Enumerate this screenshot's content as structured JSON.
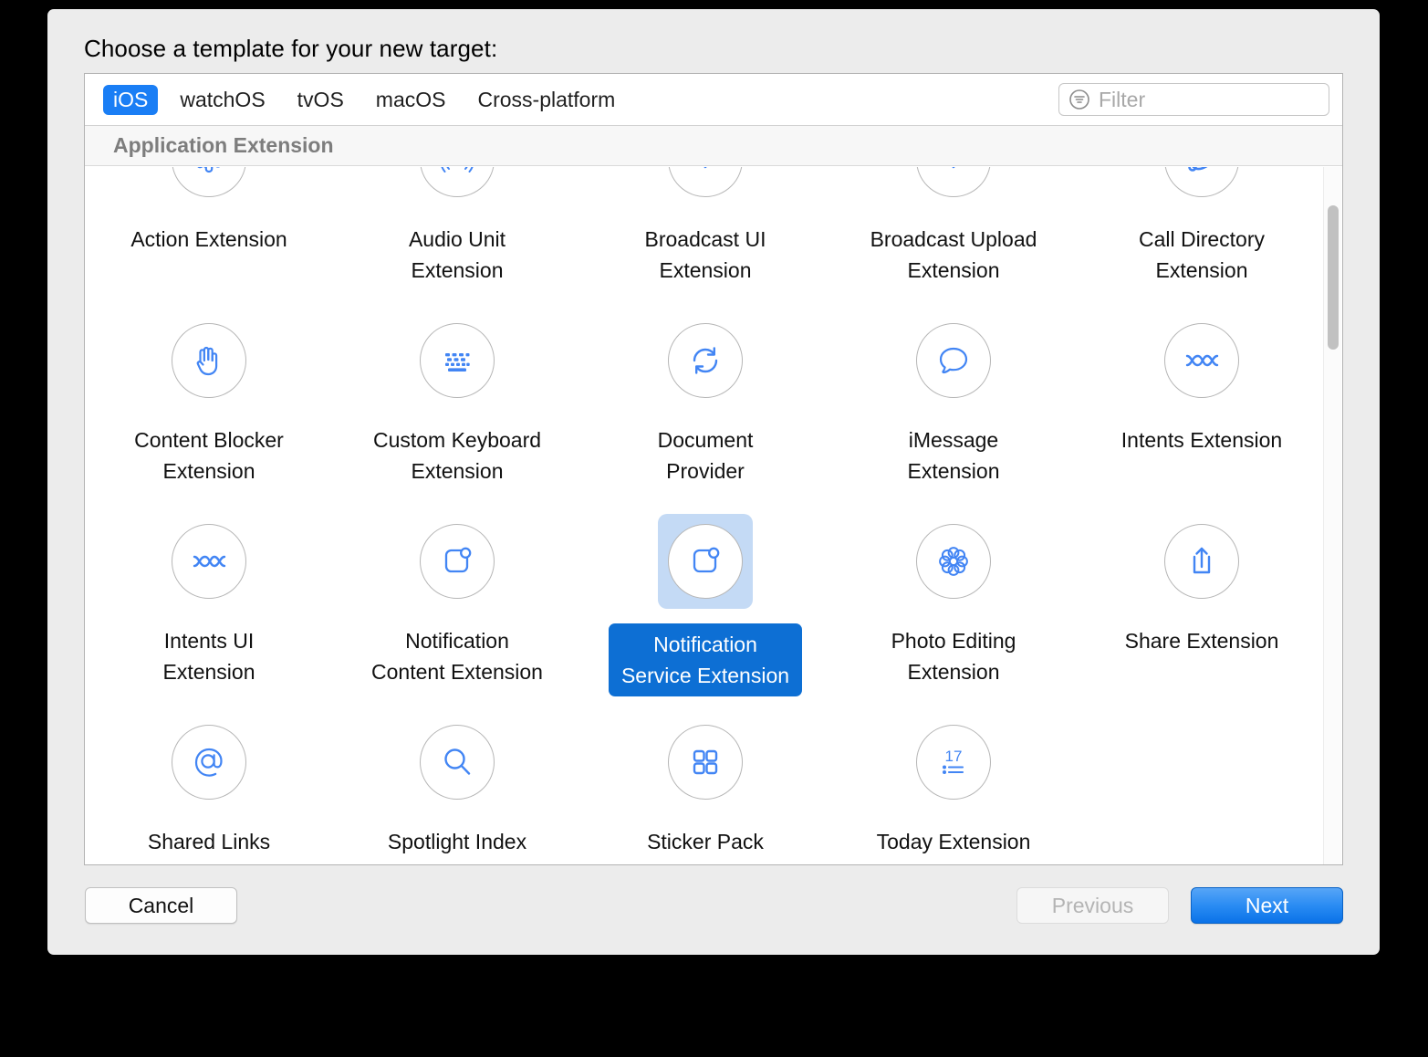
{
  "dialog": {
    "prompt": "Choose a template for your new target:"
  },
  "tabs": [
    {
      "label": "iOS",
      "selected": true
    },
    {
      "label": "watchOS",
      "selected": false
    },
    {
      "label": "tvOS",
      "selected": false
    },
    {
      "label": "macOS",
      "selected": false
    },
    {
      "label": "Cross-platform",
      "selected": false
    }
  ],
  "filter": {
    "placeholder": "Filter",
    "value": "",
    "icon": "filter-icon"
  },
  "section": {
    "title": "Application Extension"
  },
  "templates": [
    {
      "label": "Action Extension",
      "icon": "gear-icon",
      "selected": false
    },
    {
      "label": "Audio Unit\nExtension",
      "icon": "audio-waves-icon",
      "selected": false
    },
    {
      "label": "Broadcast UI\nExtension",
      "icon": "broadcast-chevrons-icon",
      "selected": false
    },
    {
      "label": "Broadcast Upload\nExtension",
      "icon": "broadcast-chevrons-icon",
      "selected": false
    },
    {
      "label": "Call Directory\nExtension",
      "icon": "phone-handset-icon",
      "selected": false
    },
    {
      "label": "Content Blocker\nExtension",
      "icon": "hand-icon",
      "selected": false
    },
    {
      "label": "Custom Keyboard\nExtension",
      "icon": "keyboard-icon",
      "selected": false
    },
    {
      "label": "Document\nProvider",
      "icon": "refresh-arrows-icon",
      "selected": false
    },
    {
      "label": "iMessage\nExtension",
      "icon": "speech-bubble-icon",
      "selected": false
    },
    {
      "label": "Intents Extension",
      "icon": "siri-waves-icon",
      "selected": false
    },
    {
      "label": "Intents UI\nExtension",
      "icon": "siri-waves-icon",
      "selected": false
    },
    {
      "label": "Notification\nContent Extension",
      "icon": "notification-badge-icon",
      "selected": false
    },
    {
      "label": "Notification\nService Extension",
      "icon": "notification-badge-icon",
      "selected": true
    },
    {
      "label": "Photo Editing\nExtension",
      "icon": "photos-flower-icon",
      "selected": false
    },
    {
      "label": "Share Extension",
      "icon": "share-upload-icon",
      "selected": false
    },
    {
      "label": "Shared Links",
      "icon": "at-sign-icon",
      "selected": false
    },
    {
      "label": "Spotlight Index",
      "icon": "magnifier-icon",
      "selected": false
    },
    {
      "label": "Sticker Pack",
      "icon": "grid-squares-icon",
      "selected": false
    },
    {
      "label": "Today Extension",
      "icon": "calendar-17-list-icon",
      "selected": false
    }
  ],
  "footer": {
    "cancel_label": "Cancel",
    "previous_label": "Previous",
    "next_label": "Next"
  },
  "colors": {
    "accent_blue": "#1a7ef5",
    "selection_tint": "#c4daf5",
    "selection_label": "#0d6fd4",
    "icon_stroke": "#4285f4",
    "window_chrome": "#ececec"
  }
}
